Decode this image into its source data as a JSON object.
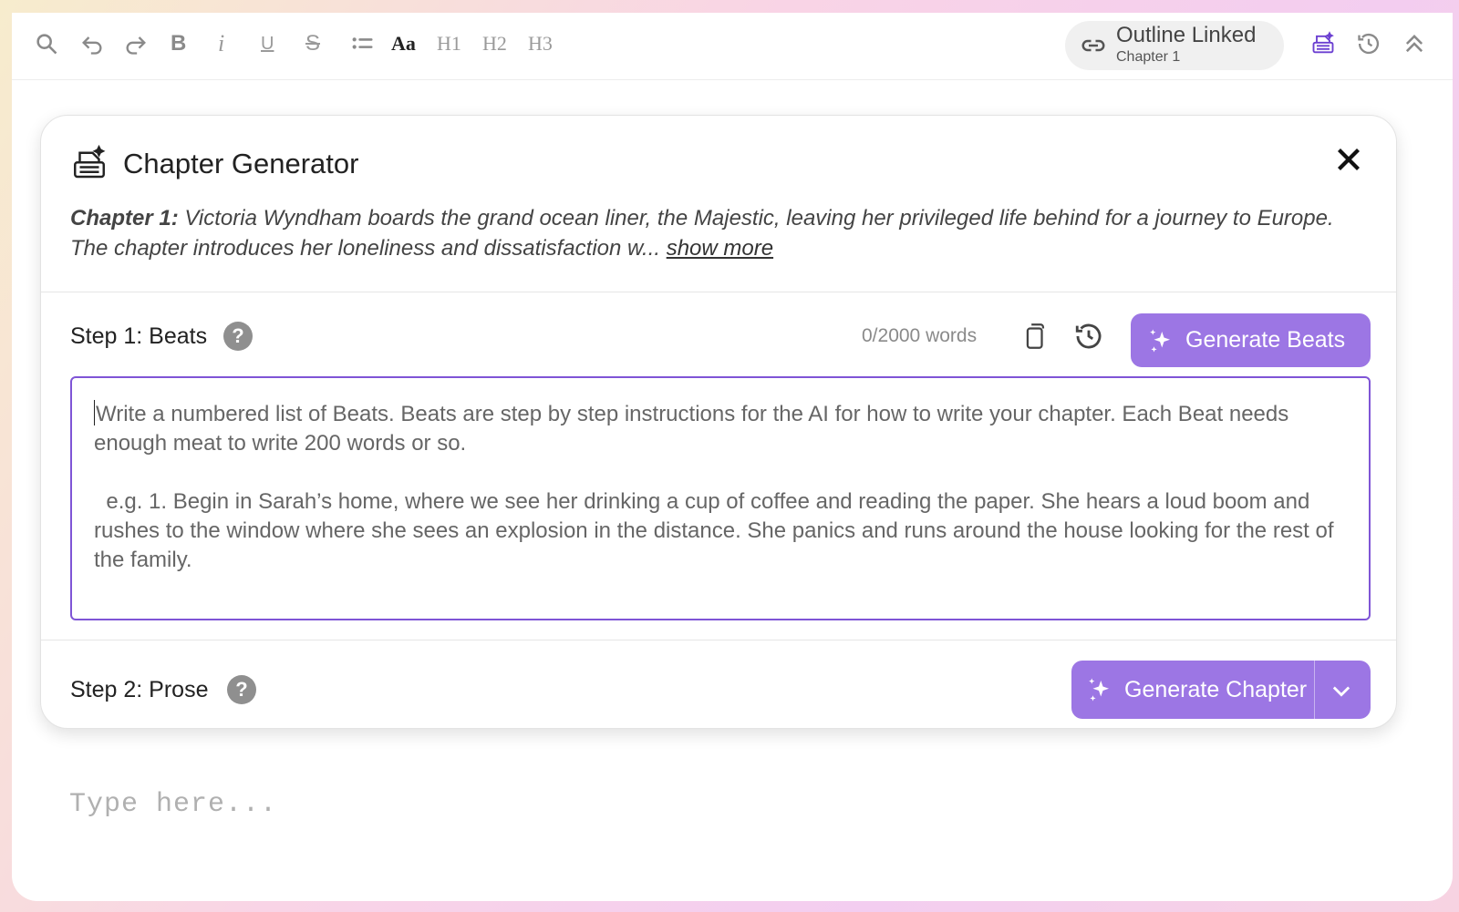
{
  "toolbar": {
    "format_aa": "Aa",
    "h1": "H1",
    "h2": "H2",
    "h3": "H3",
    "icons": [
      "search-icon",
      "undo-icon",
      "redo-icon",
      "bold-icon",
      "italic-icon",
      "underline-icon",
      "strikethrough-icon",
      "list-icon",
      "typewriter-icon",
      "history-icon",
      "collapse-icon"
    ],
    "outline": {
      "title": "Outline Linked",
      "subtitle": "Chapter 1"
    }
  },
  "generator": {
    "title": "Chapter Generator",
    "summary_label": "Chapter 1:",
    "summary_text": " Victoria Wyndham boards the grand ocean liner, the Majestic, leaving her privileged life behind for a journey to Europe. The chapter introduces her loneliness and dissatisfaction w... ",
    "show_more": "show more",
    "step1": {
      "label": "Step 1: Beats",
      "word_count": "0/2000 words",
      "button": "Generate Beats",
      "placeholder": "Write a numbered list of Beats. Beats are step by step instructions for the AI for how to write your chapter. Each Beat needs enough meat to write 200 words or so.\n\n  e.g. 1. Begin in Sarah’s home, where we see her drinking a cup of coffee and reading the paper. She hears a loud boom and rushes to the window where she sees an explosion in the distance. She panics and runs around the house looking for the rest of the family."
    },
    "step2": {
      "label": "Step 2: Prose",
      "button": "Generate Chapter"
    }
  },
  "editor": {
    "placeholder": "Type here..."
  },
  "colors": {
    "accent": "#9c76e4",
    "border_focus": "#7f55d6"
  }
}
